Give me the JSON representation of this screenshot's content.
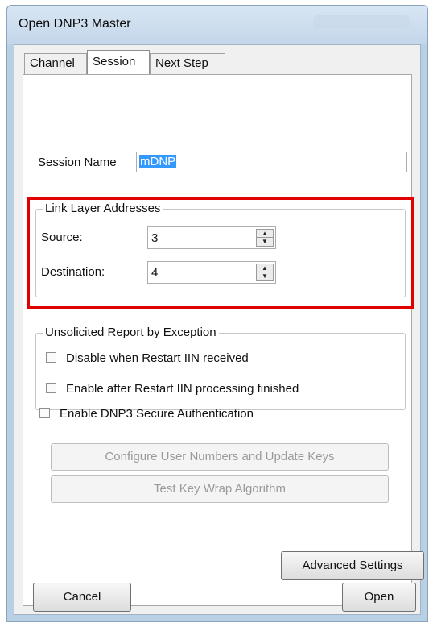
{
  "window": {
    "title": "Open DNP3 Master"
  },
  "tabs": [
    {
      "label": "Channel"
    },
    {
      "label": "Session"
    },
    {
      "label": "Next Step"
    }
  ],
  "session": {
    "name_label": "Session Name",
    "name_value": "mDNP"
  },
  "link_layer": {
    "legend": "Link Layer Addresses",
    "source_label": "Source:",
    "source_value": "3",
    "destination_label": "Destination:",
    "destination_value": "4"
  },
  "unsolicited": {
    "legend": "Unsolicited Report by Exception",
    "disable_label": "Disable when Restart IIN received",
    "enable_label": "Enable after Restart IIN processing finished"
  },
  "secure_auth": {
    "label": "Enable DNP3 Secure Authentication",
    "configure_label": "Configure User Numbers and Update Keys",
    "test_label": "Test Key Wrap Algorithm"
  },
  "footer": {
    "advanced_label": "Advanced Settings",
    "cancel_label": "Cancel",
    "open_label": "Open"
  },
  "colors": {
    "highlight": "#e10000",
    "selection": "#3399ff",
    "frame": "#b9cfe4"
  }
}
